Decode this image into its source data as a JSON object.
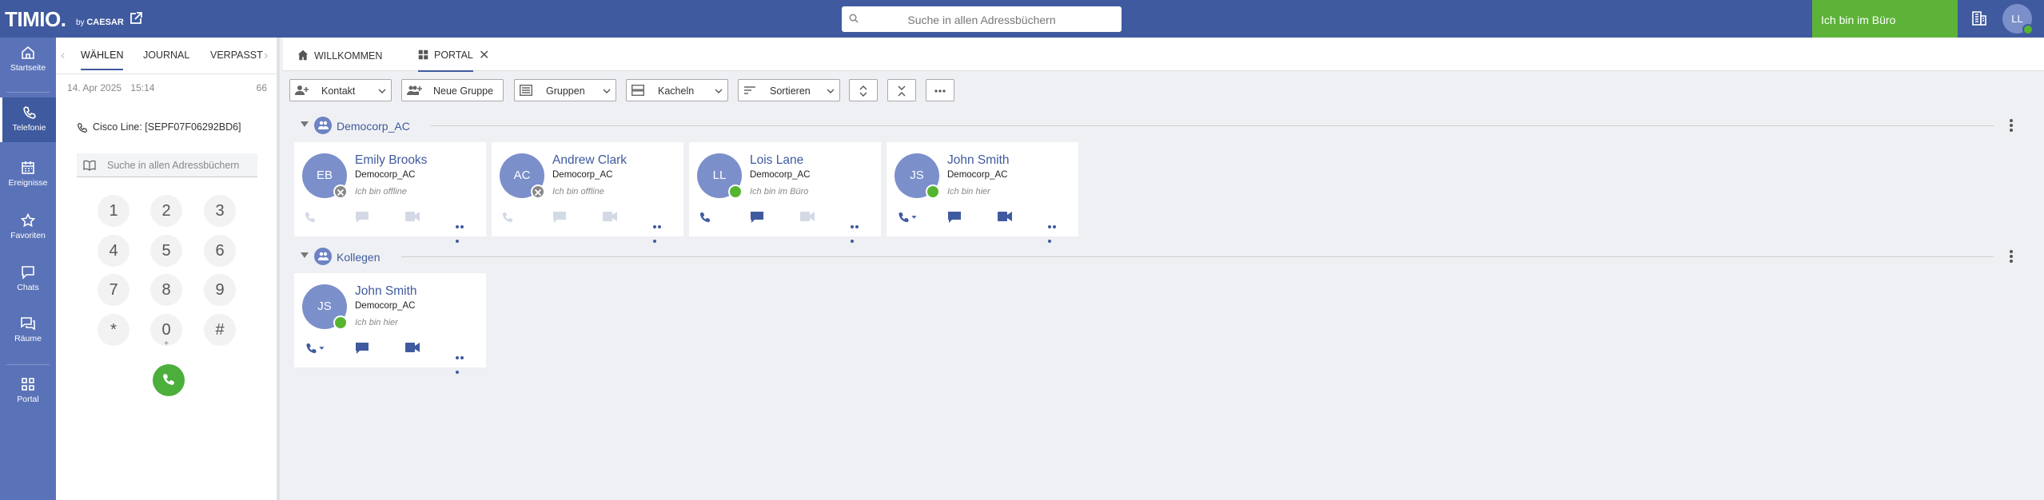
{
  "topbar": {
    "logo": "TIMIO.",
    "logo_by": "by",
    "logo_brand": "CAESAR",
    "search_placeholder": "Suche in allen Adressbüchern",
    "presence": "Ich bin im Büro",
    "user_initials": "LL",
    "colors": {
      "bar": "#3f5a9e",
      "presence": "#5cb338"
    }
  },
  "nav": {
    "items": [
      {
        "label": "Startseite",
        "icon": "home-icon"
      },
      {
        "label": "Telefonie",
        "icon": "phone-icon"
      },
      {
        "label": "Ereignisse",
        "icon": "calendar-icon"
      },
      {
        "label": "Favoriten",
        "icon": "star-icon"
      },
      {
        "label": "Chats",
        "icon": "chat-icon"
      },
      {
        "label": "Räume",
        "icon": "rooms-icon"
      },
      {
        "label": "Portal",
        "icon": "grid-icon"
      }
    ]
  },
  "phone": {
    "tabs": [
      "WÄHLEN",
      "JOURNAL",
      "VERPASST"
    ],
    "date": "14. Apr 2025",
    "time": "15:14",
    "count": "66",
    "line": "Cisco Line: [SEPF07F06292BD6]",
    "search_placeholder": "Suche in allen Adressbüchern",
    "keys": [
      "1",
      "2",
      "3",
      "4",
      "5",
      "6",
      "7",
      "8",
      "9",
      "*",
      "0",
      "#"
    ],
    "zero_sub": "+"
  },
  "main": {
    "tabs": [
      "WILLKOMMEN",
      "PORTAL"
    ],
    "toolbar": {
      "kontakt": "Kontakt",
      "neue_gruppe": "Neue Gruppe",
      "gruppen": "Gruppen",
      "kacheln": "Kacheln",
      "sortieren": "Sortieren"
    },
    "groups": [
      {
        "name": "Democorp_AC",
        "contacts": [
          {
            "initials": "EB",
            "name": "Emily Brooks",
            "company": "Democorp_AC",
            "status": "Ich bin offline",
            "state": "offline"
          },
          {
            "initials": "AC",
            "name": "Andrew Clark",
            "company": "Democorp_AC",
            "status": "Ich bin offline",
            "state": "offline"
          },
          {
            "initials": "LL",
            "name": "Lois Lane",
            "company": "Democorp_AC",
            "status": "Ich bin im Büro",
            "state": "online"
          },
          {
            "initials": "JS",
            "name": "John Smith",
            "company": "Democorp_AC",
            "status": "Ich bin hier",
            "state": "online"
          }
        ]
      },
      {
        "name": "Kollegen",
        "contacts": [
          {
            "initials": "JS",
            "name": "John Smith",
            "company": "Democorp_AC",
            "status": "Ich bin hier",
            "state": "online"
          }
        ]
      }
    ]
  }
}
